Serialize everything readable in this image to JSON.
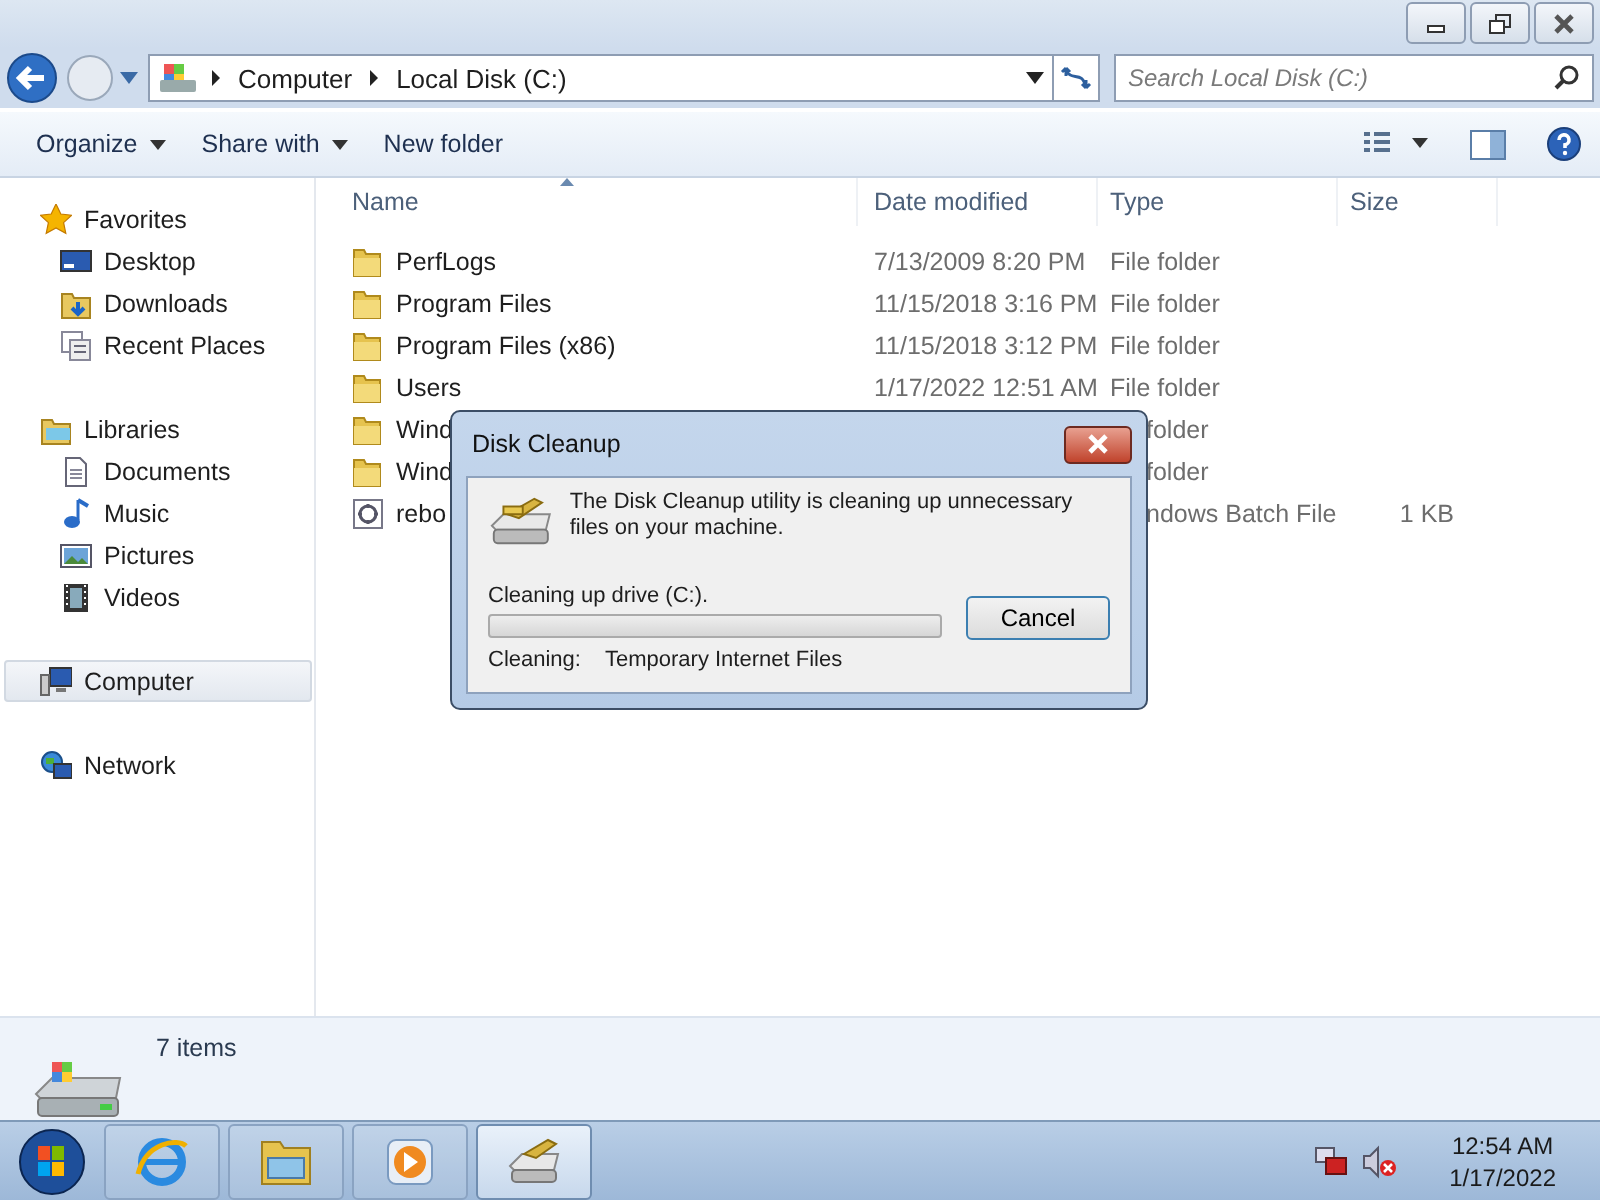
{
  "address": {
    "crumbs": [
      "Computer",
      "Local Disk (C:)"
    ],
    "search_placeholder": "Search Local Disk (C:)"
  },
  "toolbar": [
    {
      "label": "Organize",
      "has_menu": true
    },
    {
      "label": "Share with",
      "has_menu": true
    },
    {
      "label": "New folder",
      "has_menu": false
    }
  ],
  "sidebar": [
    {
      "label": "Favorites",
      "selected": false,
      "children": [
        {
          "label": "Desktop",
          "selected": false
        },
        {
          "label": "Downloads",
          "selected": false
        },
        {
          "label": "Recent Places",
          "selected": false
        }
      ]
    },
    {
      "label": "Libraries",
      "selected": false,
      "children": [
        {
          "label": "Documents",
          "selected": false
        },
        {
          "label": "Music",
          "selected": false
        },
        {
          "label": "Pictures",
          "selected": false
        },
        {
          "label": "Videos",
          "selected": false
        }
      ]
    },
    {
      "label": "Computer",
      "selected": true
    },
    {
      "label": "Network",
      "selected": false
    }
  ],
  "columns": [
    "Name",
    "Date modified",
    "Type",
    "Size"
  ],
  "files": [
    {
      "kind": "folder",
      "name": "PerfLogs",
      "date": "7/13/2009 8:20 PM",
      "type": "File folder"
    },
    {
      "kind": "folder",
      "name": "Program Files",
      "date": "11/15/2018 3:16 PM",
      "type": "File folder"
    },
    {
      "kind": "folder",
      "name": "Program Files (x86)",
      "date": "11/15/2018 3:12 PM",
      "type": "File folder"
    },
    {
      "kind": "folder",
      "name": "Users",
      "date": "1/17/2022 12:51 AM",
      "type": "File folder"
    },
    {
      "kind": "folder",
      "name": "Wind",
      "type": "folder"
    },
    {
      "kind": "folder",
      "name": "Wind",
      "type": "folder"
    },
    {
      "kind": "batch",
      "name": "rebo",
      "type": "ndows Batch File",
      "size": "1 KB"
    }
  ],
  "status": "7 items",
  "dialog": {
    "title": "Disk Cleanup",
    "message": "The Disk Cleanup utility is cleaning up unnecessary files on your machine.",
    "progress_label": "Cleaning up drive  (C:).",
    "level": 0,
    "button": "Cancel",
    "current_label": "Cleaning:",
    "current_item": "Temporary Internet Files"
  },
  "taskbar": {
    "apps": [
      {
        "kind": "browser",
        "selected": false
      },
      {
        "kind": "explorer",
        "selected": false
      },
      {
        "kind": "media",
        "selected": false
      },
      {
        "kind": "cleanup",
        "selected": true
      }
    ],
    "time": "12:54 AM",
    "date": "1/17/2022"
  }
}
